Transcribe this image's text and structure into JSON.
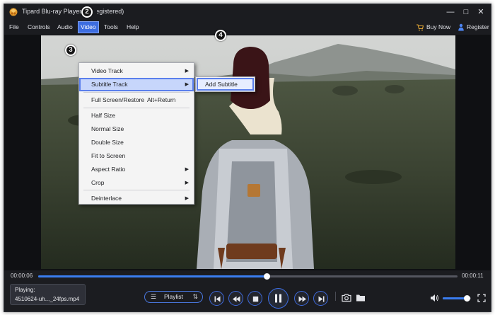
{
  "window": {
    "title": "Tipard Blu-ray Player (Unregistered)",
    "controls": {
      "minimize": "—",
      "maximize": "□",
      "close": "✕"
    }
  },
  "menubar": {
    "items": [
      "File",
      "Controls",
      "Audio",
      "Video",
      "Tools",
      "Help"
    ],
    "active": "Video",
    "buy_now": "Buy Now",
    "register": "Register"
  },
  "video_menu": {
    "items": [
      {
        "label": "Video Track",
        "submenu": true
      },
      {
        "label": "Subtitle Track",
        "submenu": true,
        "highlighted": true
      },
      {
        "label": "Full Screen/Restore",
        "shortcut": "Alt+Return"
      },
      {
        "label": "Half Size"
      },
      {
        "label": "Normal Size"
      },
      {
        "label": "Double Size"
      },
      {
        "label": "Fit to Screen"
      },
      {
        "label": "Aspect Ratio",
        "submenu": true
      },
      {
        "label": "Crop",
        "submenu": true
      },
      {
        "label": "Deinterlace",
        "submenu": true
      }
    ],
    "submenu_subtitle": {
      "items": [
        "Add Subtitle"
      ]
    }
  },
  "annotations": [
    "2",
    "3",
    "4"
  ],
  "playback": {
    "current_time": "00:00:06",
    "total_time": "00:00:11",
    "progress": 0.545,
    "playing_label": "Playing:",
    "file_name": "4510624-uh..._24fps.mp4",
    "playlist_label": "Playlist",
    "volume": 0.84
  },
  "icons": {
    "app": "app-logo-icon",
    "buy": "cart-icon",
    "register": "person-key-icon",
    "playlist": "list-icon",
    "sort": "sort-icon",
    "controls": [
      "skip-back-icon",
      "rewind-icon",
      "stop-icon",
      "pause-icon",
      "fast-forward-icon",
      "skip-forward-icon",
      "snapshot-icon",
      "folder-icon",
      "volume-icon",
      "fullscreen-icon"
    ]
  },
  "colors": {
    "accent": "#3d6de0",
    "menu_highlight": "#c7d6fb",
    "window_bg": "#1b1c20"
  }
}
